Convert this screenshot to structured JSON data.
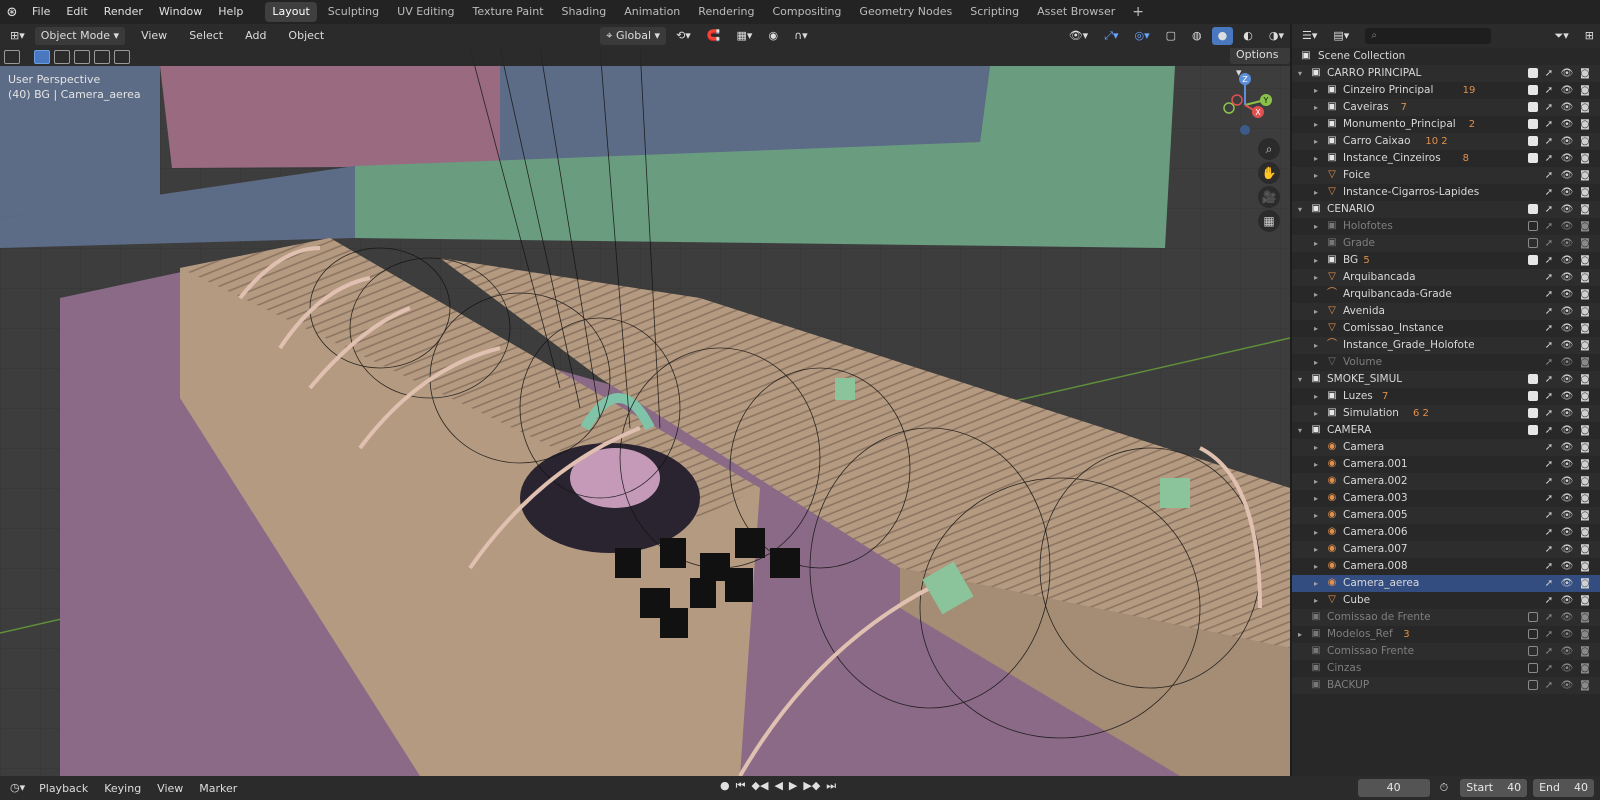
{
  "topbar": {
    "menus": [
      "File",
      "Edit",
      "Render",
      "Window",
      "Help"
    ],
    "workspaces": [
      "Layout",
      "Sculpting",
      "UV Editing",
      "Texture Paint",
      "Shading",
      "Animation",
      "Rendering",
      "Compositing",
      "Geometry Nodes",
      "Scripting",
      "Asset Browser"
    ],
    "active_workspace": "Layout",
    "add_tab": "+"
  },
  "viewport_header": {
    "mode": "Object Mode",
    "menus": [
      "View",
      "Select",
      "Add",
      "Object"
    ],
    "orientation": "Global"
  },
  "viewport": {
    "perspective_label": "User Perspective",
    "object_label": "(40) BG | Camera_aerea",
    "options_label": "Options",
    "gizmo": {
      "z": "Z",
      "y": "Y",
      "x": "X"
    }
  },
  "outliner": {
    "search_placeholder": "",
    "root": "Scene Collection",
    "rows": [
      {
        "name": "CARRO PRINCIPAL",
        "level": 1,
        "type": "collection",
        "expanded": true,
        "checked": true,
        "dim": false,
        "extra": ""
      },
      {
        "name": "Cinzeiro Principal",
        "level": 2,
        "type": "collection",
        "checked": true,
        "dim": false,
        "extra": "19"
      },
      {
        "name": "Caveiras",
        "level": 2,
        "type": "collection",
        "checked": true,
        "dim": false,
        "extra": "7"
      },
      {
        "name": "Monumento_Principal",
        "level": 2,
        "type": "collection",
        "checked": true,
        "dim": false,
        "extra": "2"
      },
      {
        "name": "Carro Caixao",
        "level": 2,
        "type": "collection",
        "checked": true,
        "dim": false,
        "extra": "10 2"
      },
      {
        "name": "Instance_Cinzeiros",
        "level": 2,
        "type": "collection",
        "checked": true,
        "dim": false,
        "extra": "8"
      },
      {
        "name": "Foice",
        "level": 2,
        "type": "mesh",
        "checked": null,
        "dim": false,
        "extra": ""
      },
      {
        "name": "Instance-Cigarros-Lapides",
        "level": 2,
        "type": "mesh",
        "checked": null,
        "dim": false,
        "extra": ""
      },
      {
        "name": "CENARIO",
        "level": 1,
        "type": "collection",
        "expanded": true,
        "checked": true,
        "dim": false,
        "extra": ""
      },
      {
        "name": "Holofotes",
        "level": 2,
        "type": "collection",
        "checked": false,
        "dim": true,
        "extra": ""
      },
      {
        "name": "Grade",
        "level": 2,
        "type": "collection",
        "checked": false,
        "dim": true,
        "extra": ""
      },
      {
        "name": "BG",
        "level": 2,
        "type": "collection",
        "checked": true,
        "dim": false,
        "extra": "5"
      },
      {
        "name": "Arquibancada",
        "level": 2,
        "type": "mesh",
        "checked": null,
        "dim": false,
        "extra": ""
      },
      {
        "name": "Arquibancada-Grade",
        "level": 2,
        "type": "curve",
        "checked": null,
        "dim": false,
        "extra": ""
      },
      {
        "name": "Avenida",
        "level": 2,
        "type": "mesh",
        "checked": null,
        "dim": false,
        "extra": ""
      },
      {
        "name": "Comissao_Instance",
        "level": 2,
        "type": "mesh",
        "checked": null,
        "dim": false,
        "extra": ""
      },
      {
        "name": "Instance_Grade_Holofote",
        "level": 2,
        "type": "curve",
        "checked": null,
        "dim": false,
        "extra": ""
      },
      {
        "name": "Volume",
        "level": 2,
        "type": "mesh",
        "checked": null,
        "dim": true,
        "extra": ""
      },
      {
        "name": "SMOKE_SIMUL",
        "level": 1,
        "type": "collection",
        "expanded": true,
        "checked": true,
        "dim": false,
        "extra": ""
      },
      {
        "name": "Luzes",
        "level": 2,
        "type": "collection",
        "checked": true,
        "dim": false,
        "extra": "7"
      },
      {
        "name": "Simulation",
        "level": 2,
        "type": "collection",
        "checked": true,
        "dim": false,
        "extra": "6 2"
      },
      {
        "name": "CAMERA",
        "level": 1,
        "type": "collection",
        "expanded": true,
        "checked": true,
        "dim": false,
        "extra": ""
      },
      {
        "name": "Camera",
        "level": 2,
        "type": "camera",
        "checked": null,
        "dim": false,
        "extra": ""
      },
      {
        "name": "Camera.001",
        "level": 2,
        "type": "camera",
        "checked": null,
        "dim": false,
        "extra": ""
      },
      {
        "name": "Camera.002",
        "level": 2,
        "type": "camera",
        "checked": null,
        "dim": false,
        "extra": ""
      },
      {
        "name": "Camera.003",
        "level": 2,
        "type": "camera",
        "checked": null,
        "dim": false,
        "extra": ""
      },
      {
        "name": "Camera.005",
        "level": 2,
        "type": "camera",
        "checked": null,
        "dim": false,
        "extra": ""
      },
      {
        "name": "Camera.006",
        "level": 2,
        "type": "camera",
        "checked": null,
        "dim": false,
        "extra": ""
      },
      {
        "name": "Camera.007",
        "level": 2,
        "type": "camera",
        "checked": null,
        "dim": false,
        "extra": ""
      },
      {
        "name": "Camera.008",
        "level": 2,
        "type": "camera",
        "checked": null,
        "dim": false,
        "extra": ""
      },
      {
        "name": "Camera_aerea",
        "level": 2,
        "type": "camera",
        "checked": null,
        "dim": false,
        "extra": "",
        "selected": true
      },
      {
        "name": "Cube",
        "level": 2,
        "type": "mesh",
        "checked": null,
        "dim": false,
        "extra": ""
      },
      {
        "name": "Comissao de Frente",
        "level": 1,
        "type": "collection",
        "checked": false,
        "dim": true,
        "extra": ""
      },
      {
        "name": "Modelos_Ref",
        "level": 1,
        "type": "collection",
        "expanded": false,
        "checked": false,
        "dim": true,
        "extra": "3"
      },
      {
        "name": "Comissao Frente",
        "level": 1,
        "type": "collection",
        "checked": false,
        "dim": true,
        "extra": ""
      },
      {
        "name": "Cinzas",
        "level": 1,
        "type": "collection",
        "checked": false,
        "dim": true,
        "extra": ""
      },
      {
        "name": "BACKUP",
        "level": 1,
        "type": "collection",
        "checked": false,
        "dim": true,
        "extra": ""
      }
    ]
  },
  "timeline": {
    "menus": [
      "Playback",
      "Keying",
      "View",
      "Marker"
    ],
    "current_frame": "40",
    "start_label": "Start",
    "start": "40",
    "end_label": "End",
    "end": "40"
  },
  "colors": {
    "accent": "#4a78c0",
    "stand": "#b49a80",
    "floor": "#8a6a86",
    "wall_blue": "#5c6b86",
    "wall_green": "#6a9c80",
    "wall_pink": "#9a6a80"
  }
}
